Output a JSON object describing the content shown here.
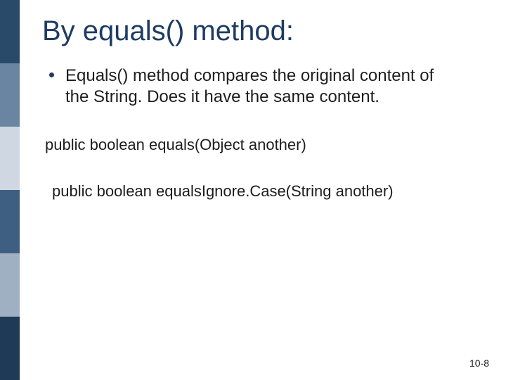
{
  "slide": {
    "title": "By equals() method:",
    "bullet": "Equals() method compares the original content of the String.   Does it have the same content.",
    "code1": "public boolean equals(Object another)",
    "code2": "public boolean equalsIgnore.Case(String another)",
    "page_number": "10-8"
  }
}
